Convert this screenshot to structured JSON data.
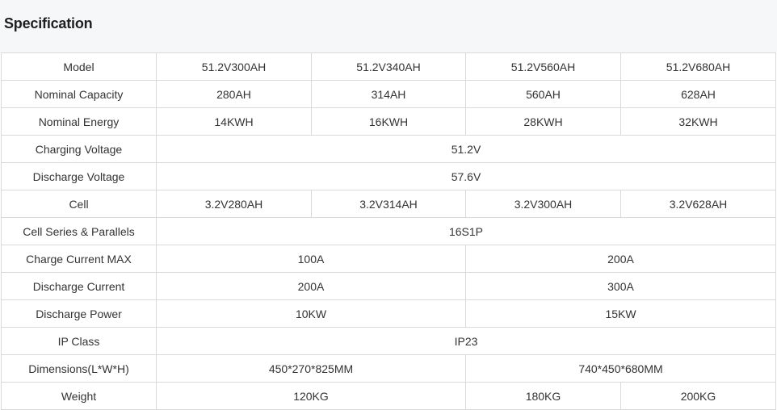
{
  "header": {
    "title": "Specification"
  },
  "table": {
    "rows": [
      {
        "label": "Model",
        "cells": [
          {
            "value": "51.2V300AH",
            "span": 1
          },
          {
            "value": "51.2V340AH",
            "span": 1
          },
          {
            "value": "51.2V560AH",
            "span": 1
          },
          {
            "value": "51.2V680AH",
            "span": 1
          }
        ]
      },
      {
        "label": "Nominal Capacity",
        "cells": [
          {
            "value": "280AH",
            "span": 1
          },
          {
            "value": "314AH",
            "span": 1
          },
          {
            "value": "560AH",
            "span": 1
          },
          {
            "value": "628AH",
            "span": 1
          }
        ]
      },
      {
        "label": "Nominal Energy",
        "cells": [
          {
            "value": "14KWH",
            "span": 1
          },
          {
            "value": "16KWH",
            "span": 1
          },
          {
            "value": "28KWH",
            "span": 1
          },
          {
            "value": "32KWH",
            "span": 1
          }
        ]
      },
      {
        "label": "Charging Voltage",
        "cells": [
          {
            "value": "51.2V",
            "span": 4
          }
        ]
      },
      {
        "label": "Discharge Voltage",
        "cells": [
          {
            "value": "57.6V",
            "span": 4
          }
        ]
      },
      {
        "label": "Cell",
        "cells": [
          {
            "value": "3.2V280AH",
            "span": 1
          },
          {
            "value": "3.2V314AH",
            "span": 1
          },
          {
            "value": "3.2V300AH",
            "span": 1
          },
          {
            "value": "3.2V628AH",
            "span": 1
          }
        ]
      },
      {
        "label": "Cell Series & Parallels",
        "cells": [
          {
            "value": "16S1P",
            "span": 4
          }
        ]
      },
      {
        "label": "Charge Current MAX",
        "cells": [
          {
            "value": "100A",
            "span": 2
          },
          {
            "value": "200A",
            "span": 2
          }
        ]
      },
      {
        "label": "Discharge Current",
        "cells": [
          {
            "value": "200A",
            "span": 2
          },
          {
            "value": "300A",
            "span": 2
          }
        ]
      },
      {
        "label": "Discharge Power",
        "cells": [
          {
            "value": "10KW",
            "span": 2
          },
          {
            "value": "15KW",
            "span": 2
          }
        ]
      },
      {
        "label": "IP Class",
        "cells": [
          {
            "value": "IP23",
            "span": 4
          }
        ]
      },
      {
        "label": "Dimensions(L*W*H)",
        "cells": [
          {
            "value": "450*270*825MM",
            "span": 2
          },
          {
            "value": "740*450*680MM",
            "span": 2
          }
        ]
      },
      {
        "label": "Weight",
        "cells": [
          {
            "value": "120KG",
            "span": 2
          },
          {
            "value": "180KG",
            "span": 1
          },
          {
            "value": "200KG",
            "span": 1
          }
        ]
      }
    ]
  }
}
